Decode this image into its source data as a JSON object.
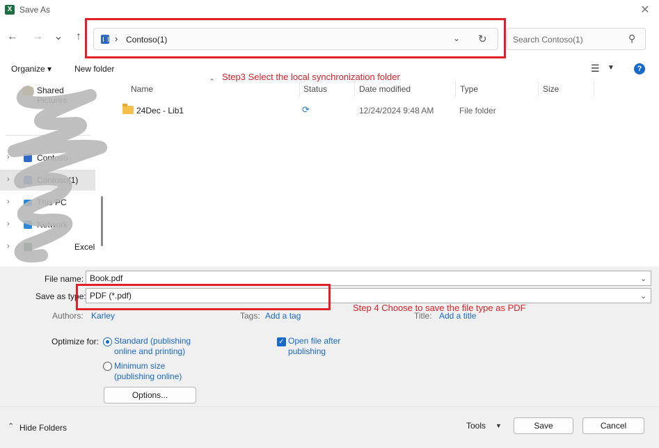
{
  "window": {
    "title": "Save As",
    "app_icon": "excel-icon"
  },
  "nav": {
    "back": "←",
    "forward": "→",
    "recent": "⌄",
    "up": "↑"
  },
  "address": {
    "separator": "›",
    "location": "Contoso(1)",
    "dropdown": "⌄",
    "refresh": "↻"
  },
  "search": {
    "placeholder": "Search Contoso(1)",
    "icon": "⚲"
  },
  "toolbar": {
    "organize": "Organize ▾",
    "new_folder": "New folder",
    "view_icon": "☰",
    "view_dd": "▼",
    "help": "?"
  },
  "annotations": {
    "step3": "Step3 Select the local synchronization folder",
    "step4": "Step 4  Choose to save the file type as PDF"
  },
  "sidebar": {
    "items": [
      {
        "label": "Shared Pictures",
        "icon": "folder-icon",
        "color": "#f3c14b",
        "chevron": ""
      },
      {
        "label": "Contoso",
        "icon": "sharepoint-icon",
        "color": "#2f68c6",
        "chevron": "›"
      },
      {
        "label": "Contoso(1)",
        "icon": "sharepoint-icon",
        "color": "#2f68c6",
        "chevron": "›",
        "selected": true
      },
      {
        "label": "This PC",
        "icon": "pc-icon",
        "color": "#2b88d8",
        "chevron": "›"
      },
      {
        "label": "Network",
        "icon": "network-icon",
        "color": "#2b88d8",
        "chevron": "›"
      },
      {
        "label": "Excel",
        "icon": "excel-icon",
        "color": "#1d6f42",
        "chevron": "›"
      }
    ]
  },
  "file_list": {
    "columns": [
      "Name",
      "Status",
      "Date modified",
      "Type",
      "Size"
    ],
    "sort_indicator": "⌃",
    "rows": [
      {
        "name": "24Dec - Lib1",
        "status_icon": "sync-icon",
        "status_glyph": "⟳",
        "date": "12/24/2024 9:48 AM",
        "type": "File folder",
        "size": ""
      }
    ]
  },
  "form": {
    "file_name_label": "File name:",
    "file_name_value": "Book.pdf",
    "save_type_label": "Save as type:",
    "save_type_value": "PDF (*.pdf)",
    "dropdown_glyph": "⌄",
    "authors_label": "Authors:",
    "authors_value": "Karley",
    "tags_label": "Tags:",
    "tags_value": "Add a tag",
    "title_label": "Title:",
    "title_value": "Add a title"
  },
  "optimize": {
    "label": "Optimize for:",
    "option1_line1": "Standard (publishing",
    "option1_line2": "online and printing)",
    "option2_line1": "Minimum size",
    "option2_line2": "(publishing online)",
    "selected": "standard",
    "open_after_line1": "Open file after",
    "open_after_line2": "publishing",
    "open_after_checked": true,
    "options_button": "Options..."
  },
  "footer": {
    "hide_folders": "Hide Folders",
    "hide_chevron": "⌃",
    "tools": "Tools",
    "tools_dd": "▼",
    "save": "Save",
    "cancel": "Cancel"
  },
  "colors": {
    "accent": "#1669c8",
    "annotation_red": "#e01f26"
  }
}
